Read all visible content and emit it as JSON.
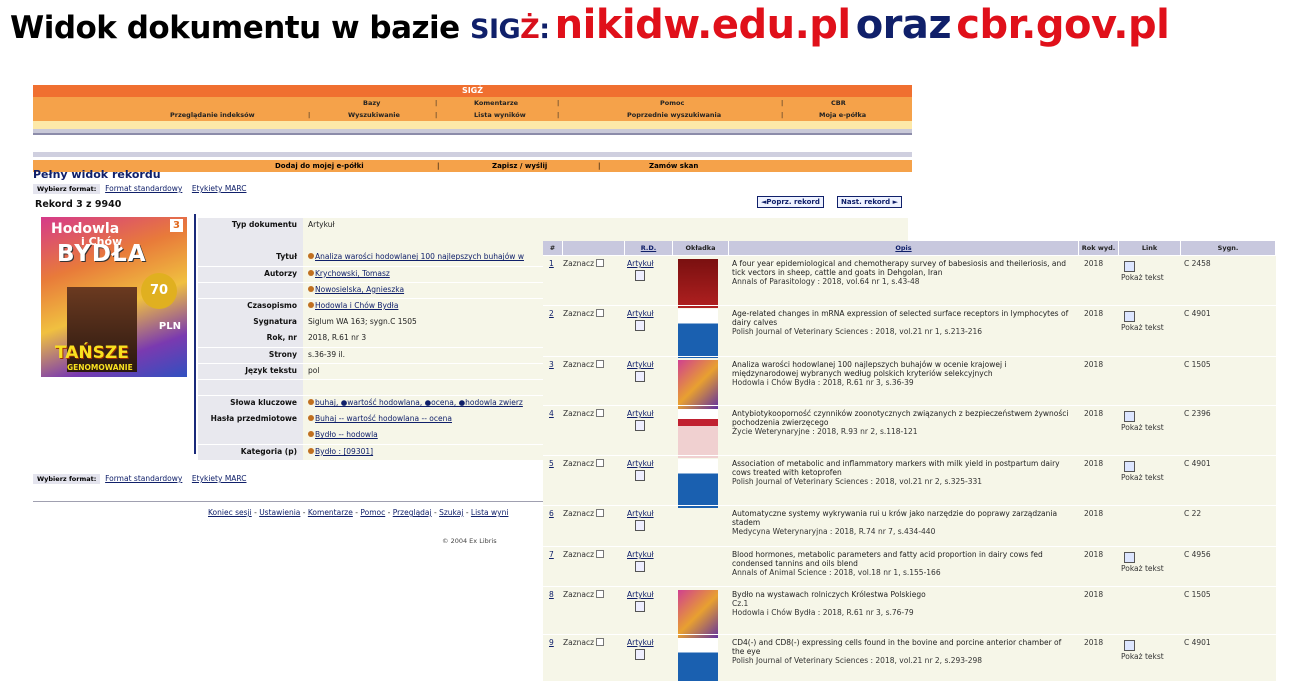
{
  "slide": {
    "title_part1": "Widok dokumentu w bazie ",
    "title_sig": "SIG",
    "title_z": "Ż",
    "title_colon": ":",
    "title_site1": "nikidw.edu.pl",
    "title_and": "oraz",
    "title_site2": "cbr.gov.pl"
  },
  "nav": {
    "top": "SIGŻ",
    "row1": [
      "Bazy",
      "Komentarze",
      "Pomoc",
      "CBR"
    ],
    "row2": [
      "Przeglądanie indeksów",
      "Wyszukiwanie",
      "Lista wyników",
      "Poprzednie wyszukiwania",
      "Moja e-półka"
    ],
    "actions": [
      "Dodaj do mojej e-półki",
      "Zapisz / wyślij",
      "Zamów skan"
    ]
  },
  "record": {
    "heading": "Pełny widok rekordu",
    "format_label": "Wybierz format:",
    "format_standard": "Format standardowy",
    "format_marc": "Etykiety MARC",
    "counter": "Rekord 3 z 9940",
    "prev": "◄Poprz. rekord",
    "next": "Nast. rekord ►",
    "cover": {
      "line1": "Hodowla",
      "line2": "i Chów",
      "line3": "BYDŁA",
      "issue": "3",
      "badge": "70",
      "pln": "PLN",
      "banner": "TAŃSZE",
      "banner2": "GENOMOWANIE"
    },
    "fields": [
      {
        "label": "Typ dokumentu",
        "value": "Artykuł",
        "link": false
      },
      {
        "label": "",
        "value": "",
        "link": false
      },
      {
        "label": "Tytuł",
        "value": "Analiza warości hodowlanej 100 najlepszych buhajów w",
        "link": true
      },
      {
        "label": "Autorzy",
        "value": "Krychowski, Tomasz",
        "link": true
      },
      {
        "label": "",
        "value": "Nowosielska, Agnieszka",
        "link": true
      },
      {
        "label": "Czasopismo",
        "value": "Hodowla i Chów Bydła",
        "link": true
      },
      {
        "label": "Sygnatura",
        "value": "Siglum WA 163; sygn.C 1505",
        "link": false
      },
      {
        "label": "Rok, nr",
        "value": "2018, R.61 nr 3",
        "link": false
      },
      {
        "label": "Strony",
        "value": "s.36-39 il.",
        "link": false
      },
      {
        "label": "Język tekstu",
        "value": "pol",
        "link": false
      },
      {
        "label": "",
        "value": "",
        "link": false
      },
      {
        "label": "Słowa kluczowe",
        "value": "buhaj, ●wartość hodowlana, ●ocena, ●hodowla zwierz",
        "link": true
      },
      {
        "label": "Hasła przedmiotowe",
        "value": "Buhaj -- wartość hodowlana -- ocena",
        "link": true
      },
      {
        "label": "",
        "value": "Bydło -- hodowla",
        "link": true
      },
      {
        "label": "Kategoria (p)",
        "value": "Bydło : [09301]",
        "link": true
      }
    ],
    "footer_links": [
      "Koniec sesji",
      "Ustawienia",
      "Komentarze",
      "Pomoc",
      "Przeglądaj",
      "Szukaj",
      "Lista wyni"
    ],
    "copyright": "© 2004 Ex Libris"
  },
  "results": {
    "headers": [
      "#",
      "",
      "R.D.",
      "Okładka",
      "Opis",
      "Rok wyd.",
      "Link",
      "Sygn."
    ],
    "select_label": "Zaznacz",
    "type_label": "Artykuł",
    "link_label": "Pokaż tekst",
    "rows": [
      {
        "n": "1",
        "title": "A four year epidemiological and chemotherapy survey of babesiosis and theileriosis, and tick vectors in sheep, cattle and goats in Dehgolan, Iran",
        "source": "Annals of Parasitology : 2018, vol.64 nr 1, s.43-48",
        "year": "2018",
        "has_link": true,
        "sygn": "C 2458",
        "thumb": "red"
      },
      {
        "n": "2",
        "title": "Age-related changes in mRNA expression of selected surface receptors in lymphocytes of dairy calves",
        "source": "Polish Journal of Veterinary Sciences : 2018, vol.21 nr 1, s.213-216",
        "year": "2018",
        "has_link": true,
        "sygn": "C 4901",
        "thumb": "blue"
      },
      {
        "n": "3",
        "title": "Analiza warości hodowlanej 100 najlepszych buhajów w ocenie krajowej i międzynarodowej wybranych według polskich kryteriów selekcyjnych",
        "source": "Hodowla i Chów Bydła : 2018, R.61 nr 3, s.36-39",
        "year": "2018",
        "has_link": false,
        "sygn": "C 1505",
        "thumb": "byd"
      },
      {
        "n": "4",
        "title": "Antybiotykooporność czynników zoonotycznych związanych z bezpieczeństwem żywności pochodzenia zwierzęcego",
        "source": "Życie Weterynaryjne : 2018, R.93 nr 2, s.118-121",
        "year": "2018",
        "has_link": true,
        "sygn": "C 2396",
        "thumb": "zyc"
      },
      {
        "n": "5",
        "title": "Association of metabolic and inflammatory markers with milk yield in postpartum dairy cows treated with ketoprofen",
        "source": "Polish Journal of Veterinary Sciences : 2018, vol.21 nr 2, s.325-331",
        "year": "2018",
        "has_link": true,
        "sygn": "C 4901",
        "thumb": "blue"
      },
      {
        "n": "6",
        "title": "Automatyczne systemy wykrywania rui u krów jako narzędzie do poprawy zarządzania stadem",
        "source": "Medycyna Weterynaryjna : 2018, R.74 nr 7, s.434-440",
        "year": "2018",
        "has_link": false,
        "sygn": "C 22",
        "thumb": ""
      },
      {
        "n": "7",
        "title": "Blood hormones, metabolic parameters and fatty acid proportion in dairy cows fed condensed tannins and oils blend",
        "source": "Annals of Animal Science : 2018, vol.18 nr 1, s.155-166",
        "year": "2018",
        "has_link": true,
        "sygn": "C 4956",
        "thumb": ""
      },
      {
        "n": "8",
        "title": "Bydło na wystawach rolniczych Królestwa Polskiego",
        "source2": "Cz.1",
        "source": "Hodowla i Chów Bydła : 2018, R.61 nr 3, s.76-79",
        "year": "2018",
        "has_link": false,
        "sygn": "C 1505",
        "thumb": "byd"
      },
      {
        "n": "9",
        "title": "CD4(-) and CD8(-) expressing cells found in the bovine and porcine anterior chamber of the eye",
        "source": "Polish Journal of Veterinary Sciences : 2018, vol.21 nr 2, s.293-298",
        "year": "2018",
        "has_link": true,
        "sygn": "C 4901",
        "thumb": "blue"
      }
    ]
  }
}
